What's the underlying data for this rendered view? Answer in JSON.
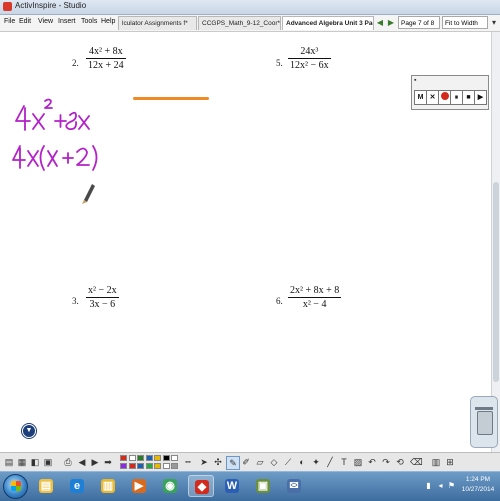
{
  "window": {
    "title": "ActivInspire - Studio"
  },
  "menubar": {
    "items": [
      "File",
      "Edit",
      "View",
      "Insert",
      "Tools",
      "Help"
    ],
    "tabs": [
      {
        "label": "lculator Assignments f*",
        "active": false
      },
      {
        "label": "CCGPS_Math_9-12_Coor*",
        "active": false
      },
      {
        "label": "Advanced Algebra Unit 3 Pack",
        "active": true
      }
    ],
    "page_indicator": "Page 7 of 8",
    "zoom": "Fit to Width"
  },
  "worksheet": {
    "problems": [
      {
        "number": "2.",
        "numerator": "4x² + 8x",
        "denominator": "12x + 24"
      },
      {
        "number": "5.",
        "numerator": "24x³",
        "denominator": "12x² − 6x"
      },
      {
        "number": "3.",
        "numerator": "x² − 2x",
        "denominator": "3x − 6"
      },
      {
        "number": "6.",
        "numerator": "2x² + 8x + 8",
        "denominator": "x² − 4"
      }
    ],
    "handwriting": {
      "line1": "4x² + 8x",
      "line2": "4x(x + 2)",
      "color": "#b321c8"
    },
    "highlight_color": "#f08a24"
  },
  "recorder": {
    "buttons": [
      "M",
      "✕",
      "●",
      "⏸",
      "■",
      "▶"
    ]
  },
  "palette": [
    "#d42a1c",
    "#ffffff",
    "#2a7a2a",
    "#1d5fb0",
    "#e6b800",
    "#000000",
    "#ffffff",
    "#8a2be2",
    "#d42a1c",
    "#1d5fb0",
    "#27a845",
    "#e6b800",
    "#ffffff",
    "#999999"
  ],
  "taskbar": {
    "apps": [
      "windows-explorer",
      "internet-explorer",
      "file-explorer",
      "media-player",
      "chrome",
      "activinspire",
      "word",
      "app-8",
      "app-9"
    ],
    "time": "1:24 PM",
    "date": "10/27/2014"
  }
}
